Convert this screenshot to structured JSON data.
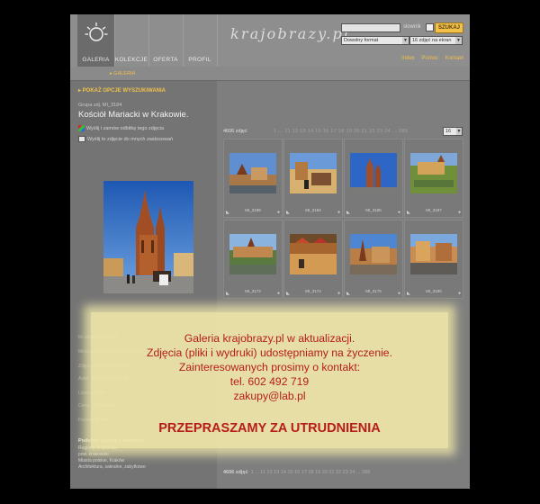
{
  "header": {
    "nav": [
      "GALERIA",
      "KOLEKCJE",
      "OFERTA",
      "PROFIL"
    ],
    "logo": "krajobrazy.pl",
    "search": {
      "value": "",
      "dictionary_label": "słownik",
      "button": "SZUKAJ"
    },
    "format_select": "Dowolny format",
    "per_page_select": "16 zdjęć na ekran",
    "links": [
      "Index",
      "Pomoc",
      "Kontakt"
    ]
  },
  "breadcrumb": "▸ GALERIA",
  "left": {
    "options_toggle": "▸ POKAŻ OPCJE WYSZUKIWANIA",
    "photo_label": "Grupa zdj. MI_3184",
    "photo_title": "Kościół Mariacki w Krakowie.",
    "actions": [
      "Wyślij i zamów odbitkę tego zdjęcia",
      "Wyślij to zdjęcie do mnych zastosowań"
    ],
    "faded_lines": [
      "Nr zdjęcia: MI_3184",
      "Miejsce: Kraków, Rynek Główny",
      "Zdjęcie w kolekcji: Kraków",
      "Autor: Andrzej Kuczyński",
      "Licencja: RM",
      "Cena: wg cennika",
      "Format: 35 mm"
    ],
    "similar_title": "Podobne zdjęcia z kategorii:",
    "similar": [
      "Regiony, krajobrazy",
      "pow. krakowski",
      "Miasta polskie, Kraków",
      "Architektura, sakralne, zabytkowe"
    ]
  },
  "grid": {
    "count_label": "4606 zdjęć",
    "pages": "1 ... 11 12 13 14 15 16 17 18 19 20 21 22 23 24 ... 288",
    "per_page": "16",
    "thumbs": [
      {
        "caption": "MI_3199",
        "kind": "town"
      },
      {
        "caption": "MI_3184",
        "kind": "market"
      },
      {
        "caption": "MI_3185",
        "kind": "church"
      },
      {
        "caption": "MI_3187",
        "kind": "aerial"
      },
      {
        "caption": "MI_3173",
        "kind": "city"
      },
      {
        "caption": "MI_3174",
        "kind": "stalls"
      },
      {
        "caption": "MI_3175",
        "kind": "square"
      },
      {
        "caption": "MI_3180",
        "kind": "square2"
      }
    ],
    "bottom_pager_label": "4606 zdjęć",
    "bottom_pager": "1 ... 11 12 13 14 15 16 17 18 19 20 21 22 23 24 ... 288"
  },
  "overlay": {
    "lines": [
      "Galeria krajobrazy.pl w aktualizacji.",
      "Zdjęcia (pliki i wydruki) udostępniamy na życzenie.",
      "Zainteresowanych prosimy o kontakt:",
      "tel. 602 492 719",
      "zakupy@lab.pl"
    ],
    "apology": "PRZEPRASZAMY ZA UTRUDNIENIA"
  },
  "colors": {
    "accent": "#f0c14a",
    "overlay_bg": "#efe6a8",
    "overlay_text": "#bb1513",
    "page_bg": "#000000"
  }
}
